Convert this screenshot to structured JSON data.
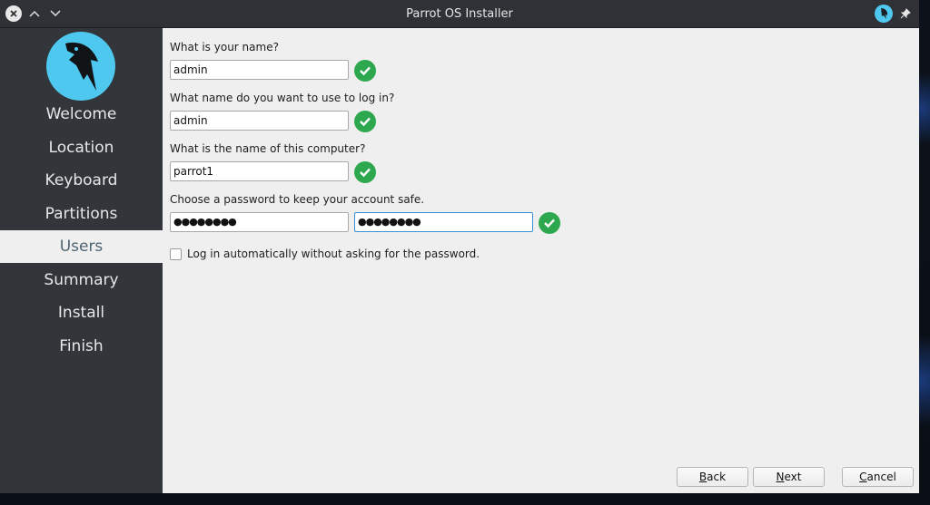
{
  "window": {
    "title": "Parrot OS Installer"
  },
  "sidebar": {
    "items": [
      {
        "label": "Welcome"
      },
      {
        "label": "Location"
      },
      {
        "label": "Keyboard"
      },
      {
        "label": "Partitions"
      },
      {
        "label": "Users",
        "active": true
      },
      {
        "label": "Summary"
      },
      {
        "label": "Install"
      },
      {
        "label": "Finish"
      }
    ]
  },
  "form": {
    "name_label": "What is your name?",
    "name_value": "admin",
    "login_label": "What name do you want to use to log in?",
    "login_value": "admin",
    "computer_label": "What is the name of this computer?",
    "computer_value": "parrot1",
    "password_label": "Choose a password to keep your account safe.",
    "password_value": "●●●●●●●●",
    "password_confirm_value": "●●●●●●●●",
    "autologin_label": "Log in automatically without asking for the password.",
    "autologin_checked": false
  },
  "buttons": {
    "back_first": "B",
    "back_rest": "ack",
    "next_first": "N",
    "next_rest": "ext",
    "cancel_first": "C",
    "cancel_rest": "ancel"
  },
  "colors": {
    "sidebar": "#323539",
    "logo": "#4fc8f0",
    "valid": "#2ea84e",
    "focus": "#3d8fd8"
  }
}
